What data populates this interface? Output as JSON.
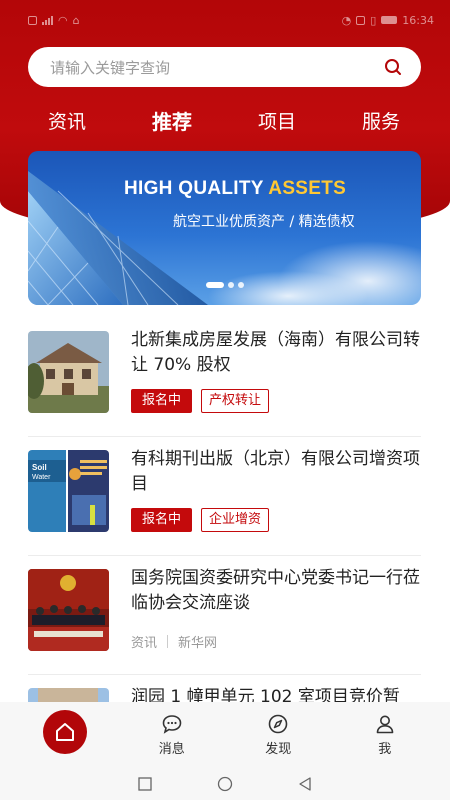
{
  "status_bar": {
    "time": "16:34"
  },
  "search": {
    "placeholder": "请输入关键字查询"
  },
  "top_tabs": [
    {
      "label": "资讯"
    },
    {
      "label": "推荐",
      "active": true
    },
    {
      "label": "项目"
    },
    {
      "label": "服务"
    }
  ],
  "banner": {
    "title_part1": "HIGH QUALITY ",
    "title_part2": "ASSETS",
    "subtitle": "航空工业优质资产 / 精选债权",
    "dot_count": 3,
    "active_dot": 0
  },
  "news": [
    {
      "title": "北新集成房屋发展（海南）有限公司转让 70% 股权",
      "status_tag": "报名中",
      "category_tag": "产权转让",
      "thumb_icon": "house-photo"
    },
    {
      "title": "有科期刊出版（北京）有限公司增资项目",
      "status_tag": "报名中",
      "category_tag": "企业增资",
      "thumb_icon": "journal-covers-photo",
      "thumb_text_1": "Soil",
      "thumb_text_2": "Water"
    },
    {
      "title": "国务院国资委研究中心党委书记一行莅临协会交流座谈",
      "source_type": "资讯",
      "source_name": "新华网",
      "thumb_icon": "meeting-photo"
    },
    {
      "title": "润园 1 幢甲单元 102 室项目竞价暂",
      "thumb_icon": "building-photo"
    }
  ],
  "bottom_nav": [
    {
      "label": "",
      "icon": "home-icon",
      "active": true
    },
    {
      "label": "消息",
      "icon": "message-icon"
    },
    {
      "label": "发现",
      "icon": "compass-icon"
    },
    {
      "label": "我",
      "icon": "user-icon"
    }
  ],
  "colors": {
    "brand_red": "#b30608",
    "tag_red": "#c40a0c",
    "highlight_yellow": "#ffc833",
    "banner_blue": "#1b56b8"
  }
}
